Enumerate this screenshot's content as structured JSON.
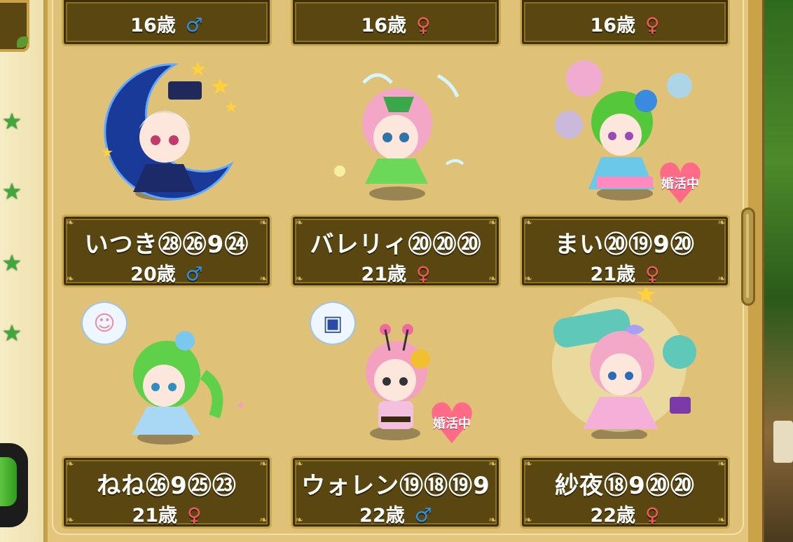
{
  "top_row": [
    {
      "name_partial": "",
      "age": "16歳",
      "gender": "♂",
      "gender_type": "male"
    },
    {
      "name_partial": "",
      "age": "16歳",
      "gender": "♀",
      "gender_type": "female"
    },
    {
      "name_partial": "",
      "age": "16歳",
      "gender": "♀",
      "gender_type": "female"
    }
  ],
  "cards": [
    {
      "name": "いつき㉘㉖9㉔",
      "age": "20歳",
      "gender": "♂",
      "gender_type": "male",
      "badge": "",
      "thought_icon": ""
    },
    {
      "name": "バレリィ⑳⑳⑳",
      "age": "21歳",
      "gender": "♀",
      "gender_type": "female",
      "badge": "",
      "thought_icon": ""
    },
    {
      "name": "まい⑳⑲9⑳",
      "age": "21歳",
      "gender": "♀",
      "gender_type": "female",
      "badge": "婚活中",
      "thought_icon": ""
    },
    {
      "name": "ねね㉖9㉕㉓",
      "age": "21歳",
      "gender": "♀",
      "gender_type": "female",
      "badge": "",
      "thought_icon": "baby-icon"
    },
    {
      "name": "ウォレン⑲⑱⑲9",
      "age": "22歳",
      "gender": "♂",
      "gender_type": "male",
      "badge": "婚活中",
      "thought_icon": "ring-box-icon"
    },
    {
      "name": "紗夜⑱9⑳⑳",
      "age": "22歳",
      "gender": "♀",
      "gender_type": "female",
      "badge": "",
      "thought_icon": ""
    }
  ],
  "sidebar": {
    "icons": [
      "star-icon",
      "star-icon",
      "star-icon",
      "star-icon"
    ]
  },
  "colors": {
    "plate": "#5a4611",
    "panel": "#dfc278",
    "male": "#2f8ee0",
    "female": "#f05a5a",
    "badge": "#ff6b86"
  }
}
